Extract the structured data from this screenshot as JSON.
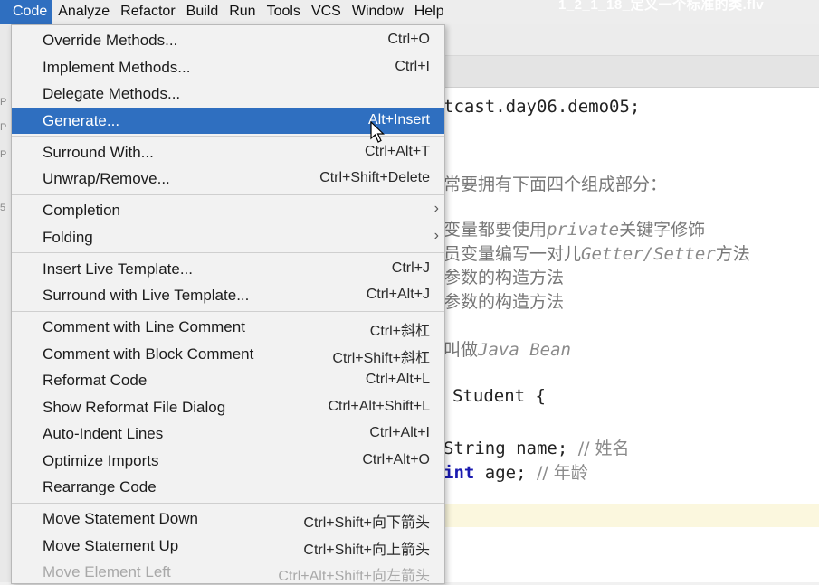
{
  "menubar": {
    "items": [
      "Code",
      "Analyze",
      "Refactor",
      "Build",
      "Run",
      "Tools",
      "VCS",
      "Window",
      "Help"
    ],
    "window_title_fragment": "1_2_1_18_定义一个标准的类.flv"
  },
  "code_menu": {
    "groups": [
      [
        {
          "label": "Override Methods...",
          "shortcut": "Ctrl+O"
        },
        {
          "label": "Implement Methods...",
          "shortcut": "Ctrl+I"
        },
        {
          "label": "Delegate Methods...",
          "shortcut": ""
        },
        {
          "label": "Generate...",
          "shortcut": "Alt+Insert",
          "selected": true
        }
      ],
      [
        {
          "label": "Surround With...",
          "shortcut": "Ctrl+Alt+T"
        },
        {
          "label": "Unwrap/Remove...",
          "shortcut": "Ctrl+Shift+Delete"
        }
      ],
      [
        {
          "label": "Completion",
          "shortcut": "",
          "submenu": true
        },
        {
          "label": "Folding",
          "shortcut": "",
          "submenu": true
        }
      ],
      [
        {
          "label": "Insert Live Template...",
          "shortcut": "Ctrl+J"
        },
        {
          "label": "Surround with Live Template...",
          "shortcut": "Ctrl+Alt+J"
        }
      ],
      [
        {
          "label": "Comment with Line Comment",
          "shortcut": "Ctrl+斜杠"
        },
        {
          "label": "Comment with Block Comment",
          "shortcut": "Ctrl+Shift+斜杠"
        },
        {
          "label": "Reformat Code",
          "shortcut": "Ctrl+Alt+L"
        },
        {
          "label": "Show Reformat File Dialog",
          "shortcut": "Ctrl+Alt+Shift+L"
        },
        {
          "label": "Auto-Indent Lines",
          "shortcut": "Ctrl+Alt+I"
        },
        {
          "label": "Optimize Imports",
          "shortcut": "Ctrl+Alt+O"
        },
        {
          "label": "Rearrange Code",
          "shortcut": ""
        }
      ],
      [
        {
          "label": "Move Statement Down",
          "shortcut": "Ctrl+Shift+向下箭头"
        },
        {
          "label": "Move Statement Up",
          "shortcut": "Ctrl+Shift+向上箭头"
        },
        {
          "label": "Move Element Left",
          "shortcut": "Ctrl+Alt+Shift+向左箭头",
          "disabled": true
        }
      ]
    ]
  },
  "editor": {
    "package_line": "tcast.day06.demo05;",
    "doc_intro": "常要拥有下面四个组成部分：",
    "doc_item1_a": "变量都要使用",
    "doc_item1_kw": "private",
    "doc_item1_b": "关键字修饰",
    "doc_item2_a": "员变量编写一对儿",
    "doc_item2_kw": "Getter/Setter",
    "doc_item2_b": "方法",
    "doc_item3": "参数的构造方法",
    "doc_item4": "参数的构造方法",
    "doc_javabean_a": "叫做",
    "doc_javabean_b": "Java Bean",
    "class_decl": "Student {",
    "field1_type": "String",
    "field1_rest": " name; ",
    "field1_comment": "// 姓名",
    "field2_type": "int",
    "field2_rest": " age; ",
    "field2_comment": "// 年龄"
  },
  "gutter": {
    "labels": [
      "P",
      "P",
      "P",
      "5"
    ]
  },
  "colors": {
    "accent": "#2f6fc0",
    "menu_bg": "#f2f2f2",
    "keyword": "#1b1bb0",
    "comment": "#8a8a8a"
  }
}
